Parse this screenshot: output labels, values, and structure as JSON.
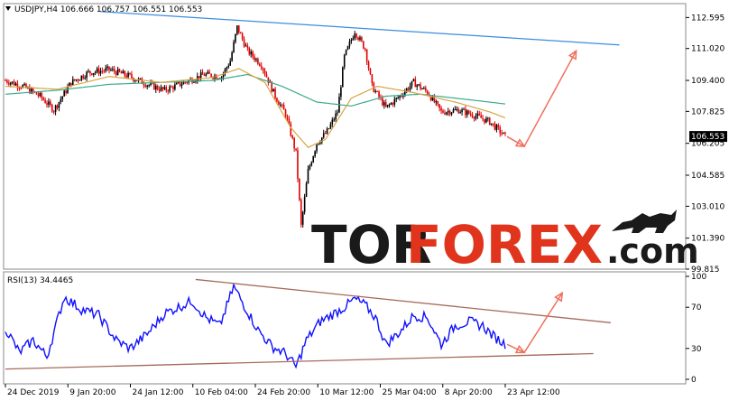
{
  "header": {
    "symbol_line": "USDJPY,H4  106.666 106.757 106.551 106.553",
    "menu_arrow_icon": "triangle-down-icon"
  },
  "rsi_header": "RSI(13) 34.4465",
  "logo": {
    "part1": "TOR",
    "part2": "FOREX",
    "part3": ".com"
  },
  "colors": {
    "candle_up": "#000000",
    "candle_down": "#e00000",
    "ma_fast": "#d9a441",
    "ma_slow": "#3aab8c",
    "trend_main": "#3b8de0",
    "trend_rsi": "#a66a5c",
    "forecast_arrow": "#f06f5c",
    "rsi_line": "#1010ff",
    "price_tag_bg": "#000000",
    "price_tag_text": "#ffffff"
  },
  "chart_data": {
    "type": "line",
    "main": {
      "price_axis_ticks": [
        "112.595",
        "111.020",
        "109.400",
        "107.825",
        "106.205",
        "104.585",
        "103.010",
        "101.390",
        "99.815"
      ],
      "price_axis_values": [
        112.595,
        111.02,
        109.4,
        107.825,
        106.205,
        104.585,
        103.01,
        101.39,
        99.815
      ],
      "ylim": [
        99.815,
        113.3
      ],
      "current_price": "106.553",
      "x_tick_labels": [
        "24 Dec 2019",
        "9 Jan 20:00",
        "24 Jan 12:00",
        "10 Feb 04:00",
        "24 Feb 20:00",
        "10 Mar 12:00",
        "25 Mar 04:00",
        "8 Apr 20:00",
        "23 Apr 12:00"
      ],
      "n_bars": 290,
      "close_path": [
        [
          0,
          109.4
        ],
        [
          10,
          109.1
        ],
        [
          20,
          108.6
        ],
        [
          28,
          107.9
        ],
        [
          38,
          109.3
        ],
        [
          48,
          109.8
        ],
        [
          60,
          109.95
        ],
        [
          72,
          109.6
        ],
        [
          82,
          109.2
        ],
        [
          92,
          108.9
        ],
        [
          102,
          109.25
        ],
        [
          115,
          109.7
        ],
        [
          125,
          109.6
        ],
        [
          130,
          110.4
        ],
        [
          134,
          112.1
        ],
        [
          140,
          110.9
        ],
        [
          148,
          110.2
        ],
        [
          156,
          108.6
        ],
        [
          162,
          107.7
        ],
        [
          168,
          105.7
        ],
        [
          171,
          102.0
        ],
        [
          175,
          104.8
        ],
        [
          180,
          106.2
        ],
        [
          186,
          106.8
        ],
        [
          192,
          107.8
        ],
        [
          196,
          110.6
        ],
        [
          202,
          111.9
        ],
        [
          208,
          111.0
        ],
        [
          212,
          109.1
        ],
        [
          220,
          108.0
        ],
        [
          228,
          108.6
        ],
        [
          236,
          109.3
        ],
        [
          244,
          108.8
        ],
        [
          252,
          107.8
        ],
        [
          262,
          107.9
        ],
        [
          272,
          107.6
        ],
        [
          280,
          107.3
        ],
        [
          289,
          106.55
        ]
      ],
      "ma_fast_path": [
        [
          0,
          109.1
        ],
        [
          30,
          108.95
        ],
        [
          60,
          109.6
        ],
        [
          90,
          109.3
        ],
        [
          120,
          109.55
        ],
        [
          135,
          110.0
        ],
        [
          150,
          109.3
        ],
        [
          165,
          107.0
        ],
        [
          175,
          106.0
        ],
        [
          185,
          106.4
        ],
        [
          200,
          108.5
        ],
        [
          215,
          109.1
        ],
        [
          235,
          108.8
        ],
        [
          260,
          108.3
        ],
        [
          280,
          107.8
        ],
        [
          289,
          107.5
        ]
      ],
      "ma_slow_path": [
        [
          0,
          108.7
        ],
        [
          30,
          108.9
        ],
        [
          60,
          109.2
        ],
        [
          90,
          109.3
        ],
        [
          120,
          109.4
        ],
        [
          140,
          109.7
        ],
        [
          160,
          109.1
        ],
        [
          180,
          108.3
        ],
        [
          200,
          108.1
        ],
        [
          220,
          108.6
        ],
        [
          240,
          108.7
        ],
        [
          260,
          108.5
        ],
        [
          280,
          108.3
        ],
        [
          289,
          108.2
        ]
      ],
      "trendline": {
        "x1": 55,
        "y1": 112.9,
        "x2": 355,
        "y2": 111.2
      },
      "forecast": [
        [
          300,
          106.05
        ],
        [
          330,
          110.9
        ]
      ]
    },
    "rsi": {
      "label": "RSI(13)",
      "last_value": 34.4465,
      "ylim": [
        0,
        100
      ],
      "levels": [
        100,
        70,
        30,
        0
      ],
      "level_labels": [
        "100",
        "70",
        "30",
        "0"
      ],
      "path": [
        [
          0,
          50
        ],
        [
          8,
          26
        ],
        [
          16,
          38
        ],
        [
          24,
          22
        ],
        [
          34,
          80
        ],
        [
          44,
          68
        ],
        [
          54,
          62
        ],
        [
          64,
          38
        ],
        [
          72,
          30
        ],
        [
          82,
          44
        ],
        [
          92,
          64
        ],
        [
          100,
          70
        ],
        [
          108,
          76
        ],
        [
          116,
          60
        ],
        [
          124,
          52
        ],
        [
          132,
          90
        ],
        [
          138,
          72
        ],
        [
          146,
          48
        ],
        [
          154,
          32
        ],
        [
          162,
          25
        ],
        [
          168,
          12
        ],
        [
          174,
          38
        ],
        [
          182,
          56
        ],
        [
          188,
          62
        ],
        [
          196,
          70
        ],
        [
          202,
          78
        ],
        [
          208,
          72
        ],
        [
          214,
          60
        ],
        [
          220,
          34
        ],
        [
          228,
          46
        ],
        [
          236,
          62
        ],
        [
          244,
          60
        ],
        [
          252,
          34
        ],
        [
          260,
          52
        ],
        [
          268,
          56
        ],
        [
          276,
          52
        ],
        [
          282,
          42
        ],
        [
          289,
          34
        ]
      ],
      "trend_upper": {
        "x1": 110,
        "y1": 97,
        "x2": 350,
        "y2": 55
      },
      "trend_lower": {
        "x1": 0,
        "y1": 10,
        "x2": 340,
        "y2": 25
      },
      "forecast": [
        [
          300,
          26
        ],
        [
          322,
          84
        ]
      ]
    }
  }
}
